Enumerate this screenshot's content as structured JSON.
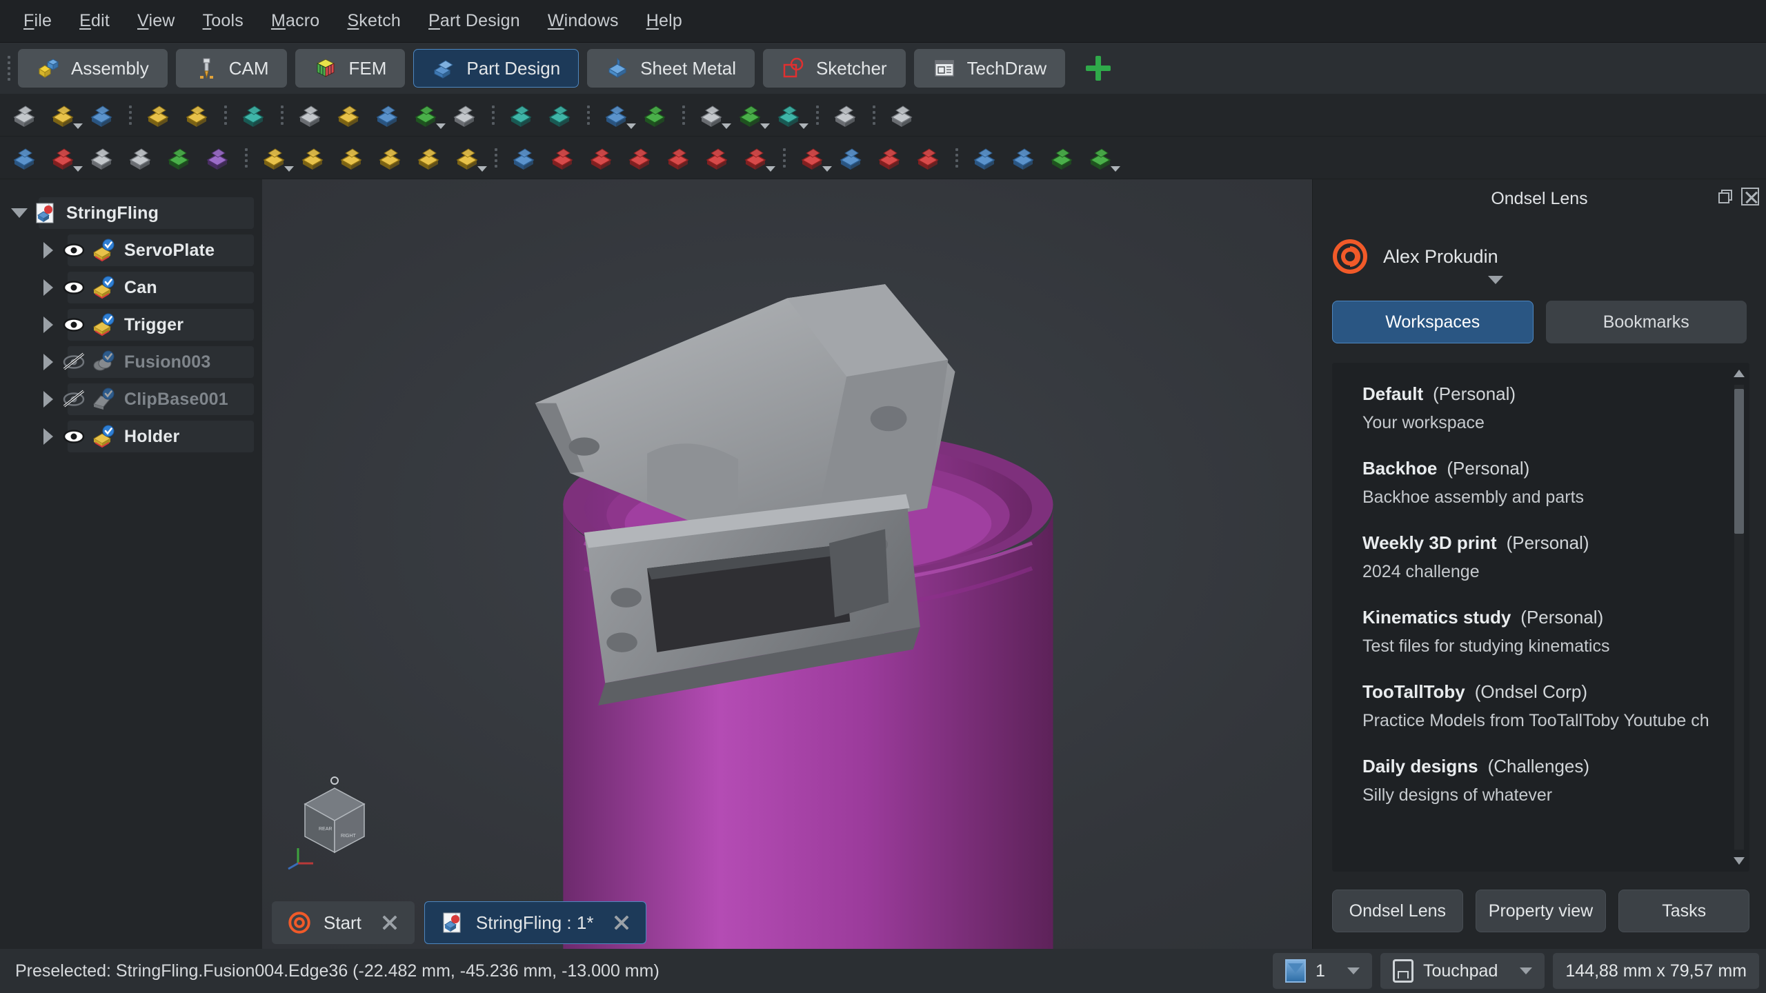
{
  "menu": {
    "items": [
      {
        "label": "File",
        "accel": "F"
      },
      {
        "label": "Edit",
        "accel": "E"
      },
      {
        "label": "View",
        "accel": "V"
      },
      {
        "label": "Tools",
        "accel": "T"
      },
      {
        "label": "Macro",
        "accel": "M"
      },
      {
        "label": "Sketch",
        "accel": "S"
      },
      {
        "label": "Part Design",
        "accel": "P"
      },
      {
        "label": "Windows",
        "accel": "W"
      },
      {
        "label": "Help",
        "accel": "H"
      }
    ]
  },
  "workbenches": {
    "tabs": [
      {
        "label": "Assembly",
        "icon": "assembly-cube-icon",
        "active": false
      },
      {
        "label": "CAM",
        "icon": "drill-bit-icon",
        "active": false
      },
      {
        "label": "FEM",
        "icon": "fem-mesh-cube-icon",
        "active": false
      },
      {
        "label": "Part Design",
        "icon": "part-design-icon",
        "active": true
      },
      {
        "label": "Sheet Metal",
        "icon": "sheet-metal-icon",
        "active": false
      },
      {
        "label": "Sketcher",
        "icon": "sketcher-icon",
        "active": false
      },
      {
        "label": "TechDraw",
        "icon": "techdraw-icon",
        "active": false
      }
    ],
    "add_label": "add-workbench"
  },
  "toolbar_row1": [
    "new-document-icon",
    "open-document-icon",
    "save-document-icon",
    "sep",
    "undo-icon",
    "redo-icon",
    "sep",
    "refresh-icon",
    "sep",
    "cut-icon",
    "copy-icon",
    "paste-icon",
    "link-icon",
    "expression-icon",
    "sep",
    "zoom-fit-icon",
    "zoom-box-icon",
    "sep",
    "axonometric-view-icon",
    "view-section-icon",
    "sep",
    "draw-style-icon",
    "selection-view-icon",
    "measure-zoom-icon",
    "sep",
    "measure-caliper-icon",
    "sep",
    "whats-this-icon"
  ],
  "toolbar_row2": [
    "create-body-icon",
    "create-sketch-icon",
    "edit-sketch-icon",
    "attachment-icon",
    "map-sketch-icon",
    "validate-sketch-icon",
    "sep",
    "pad-icon",
    "revolution-icon",
    "additive-loft-icon",
    "additive-pipe-icon",
    "additive-helix-icon",
    "additive-primitive-icon",
    "sep",
    "pocket-icon",
    "hole-icon",
    "groove-icon",
    "subtractive-loft-icon",
    "subtractive-pipe-icon",
    "subtractive-helix-icon",
    "subtractive-primitive-icon",
    "sep",
    "fillet-icon",
    "chamfer-icon",
    "draft-icon",
    "thickness-icon",
    "sep",
    "mirrored-icon",
    "linear-pattern-icon",
    "polar-pattern-icon",
    "multi-transform-icon"
  ],
  "tree": {
    "items": [
      {
        "label": "StringFling",
        "depth": 0,
        "expanded": true,
        "eye": "none",
        "icon": "document-icon",
        "hidden": false
      },
      {
        "label": "ServoPlate",
        "depth": 1,
        "expanded": false,
        "eye": "visible",
        "icon": "body-pad-icon",
        "hidden": false
      },
      {
        "label": "Can",
        "depth": 1,
        "expanded": false,
        "eye": "visible",
        "icon": "body-pad-icon",
        "hidden": false
      },
      {
        "label": "Trigger",
        "depth": 1,
        "expanded": false,
        "eye": "visible",
        "icon": "body-pad-icon",
        "hidden": false
      },
      {
        "label": "Fusion003",
        "depth": 1,
        "expanded": false,
        "eye": "hidden",
        "icon": "body-fusion-icon",
        "hidden": true
      },
      {
        "label": "ClipBase001",
        "depth": 1,
        "expanded": false,
        "eye": "hidden",
        "icon": "body-loft-icon",
        "hidden": true
      },
      {
        "label": "Holder",
        "depth": 1,
        "expanded": false,
        "eye": "visible",
        "icon": "body-pad-icon",
        "hidden": false
      }
    ]
  },
  "lens": {
    "title": "Ondsel Lens",
    "user": "Alex Prokudin",
    "logo": "ondsel-logo-icon",
    "tabs": [
      {
        "label": "Workspaces",
        "active": true
      },
      {
        "label": "Bookmarks",
        "active": false
      }
    ],
    "workspaces": [
      {
        "name": "Default",
        "owner": "(Personal)",
        "description": "Your workspace"
      },
      {
        "name": "Backhoe",
        "owner": "(Personal)",
        "description": "Backhoe assembly and parts"
      },
      {
        "name": "Weekly 3D print",
        "owner": "(Personal)",
        "description": "2024 challenge"
      },
      {
        "name": "Kinematics study",
        "owner": "(Personal)",
        "description": "Test files for studying kinematics"
      },
      {
        "name": "TooTallToby",
        "owner": "(Ondsel Corp)",
        "description": "Practice Models from TooTallToby Youtube ch"
      },
      {
        "name": "Daily designs",
        "owner": "(Challenges)",
        "description": "Silly designs of whatever"
      }
    ],
    "buttons": [
      {
        "label": "Ondsel Lens"
      },
      {
        "label": "Property view"
      },
      {
        "label": "Tasks"
      }
    ]
  },
  "doctabs": [
    {
      "label": "Start",
      "icon": "ondsel-logo-icon",
      "active": false
    },
    {
      "label": "StringFling : 1*",
      "icon": "document-icon",
      "active": true
    }
  ],
  "statusbar": {
    "message": "Preselected: StringFling.Fusion004.Edge36 (-22.482 mm, -45.236 mm, -13.000 mm)",
    "sheet_value": "1",
    "navigation": "Touchpad",
    "dimensions": "144,88 mm x 79,57 mm"
  },
  "colors": {
    "accent_blue": "#4e87c0",
    "active_tab_bg": "#1d3a59",
    "ondsel_orange": "#F15A29",
    "panel_bg": "#232629",
    "toolbar_bg": "#2b2f33",
    "model_grey": "#8d9094",
    "model_magenta": "#a83fa8"
  },
  "navcube": {
    "labels": [
      "REAR",
      "RIGHT"
    ]
  }
}
